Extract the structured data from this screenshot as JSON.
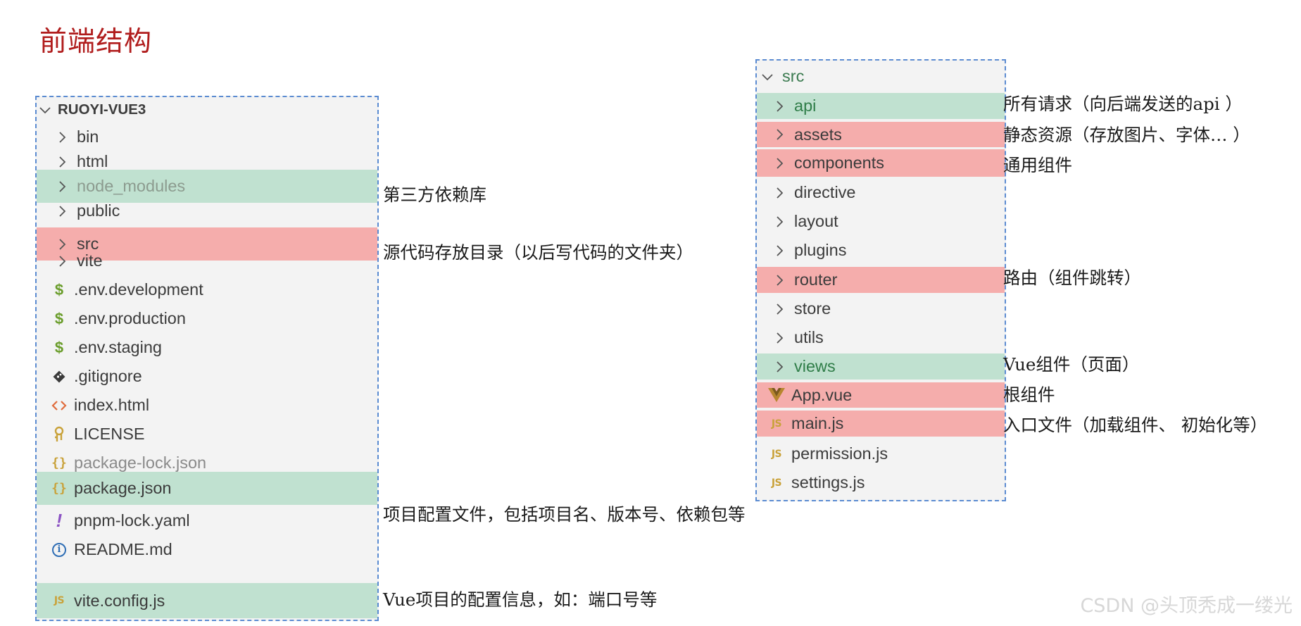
{
  "page": {
    "title": "前端结构"
  },
  "left_tree": {
    "root": "RUOYI-VUE3",
    "items": [
      {
        "label": "bin"
      },
      {
        "label": "html"
      },
      {
        "label": "node_modules"
      },
      {
        "label": "public"
      },
      {
        "label": "src"
      },
      {
        "label": "vite"
      },
      {
        "label": ".env.development"
      },
      {
        "label": ".env.production"
      },
      {
        "label": ".env.staging"
      },
      {
        "label": ".gitignore"
      },
      {
        "label": "index.html"
      },
      {
        "label": "LICENSE"
      },
      {
        "label": "package-lock.json"
      },
      {
        "label": "package.json"
      },
      {
        "label": "pnpm-lock.yaml"
      },
      {
        "label": "README.md"
      },
      {
        "label": "vite.config.js"
      }
    ]
  },
  "right_tree": {
    "root": "src",
    "items": [
      {
        "label": "api"
      },
      {
        "label": "assets"
      },
      {
        "label": "components"
      },
      {
        "label": "directive"
      },
      {
        "label": "layout"
      },
      {
        "label": "plugins"
      },
      {
        "label": "router"
      },
      {
        "label": "store"
      },
      {
        "label": "utils"
      },
      {
        "label": "views"
      },
      {
        "label": "App.vue"
      },
      {
        "label": "main.js"
      },
      {
        "label": "permission.js"
      },
      {
        "label": "settings.js"
      }
    ]
  },
  "annotations": {
    "node_modules": "第三方依赖库",
    "src": "源代码存放目录（以后写代码的文件夹）",
    "package_json": "项目配置文件，包括项目名、版本号、依赖包等",
    "vite_config": "Vue项目的配置信息，如：端口号等",
    "api": "所有请求（向后端发送的api ）",
    "assets": "静态资源（存放图片、字体… ）",
    "components": "通用组件",
    "router": "路由（组件跳转）",
    "views": "Vue组件（页面）",
    "app_vue": "根组件",
    "main_js": "入口文件（加载组件、 初始化等）"
  },
  "icons": {
    "chevron": "chevron-right-icon",
    "env": "dollar-icon",
    "git": "git-diamond-icon",
    "html": "html-brackets-icon",
    "license": "license-key-icon",
    "json": "json-braces-icon",
    "yaml": "yaml-exclamation-icon",
    "readme": "info-icon",
    "js": "js-icon",
    "vue": "vue-logo-icon"
  },
  "colors": {
    "title": "#b01c1c",
    "highlight_green": "#c0e1d0",
    "highlight_red": "#f5adac",
    "dashed_border": "#5b8bd1",
    "tree_bg": "#f3f3f3"
  },
  "watermark": "CSDN @头顶秃成一缕光"
}
